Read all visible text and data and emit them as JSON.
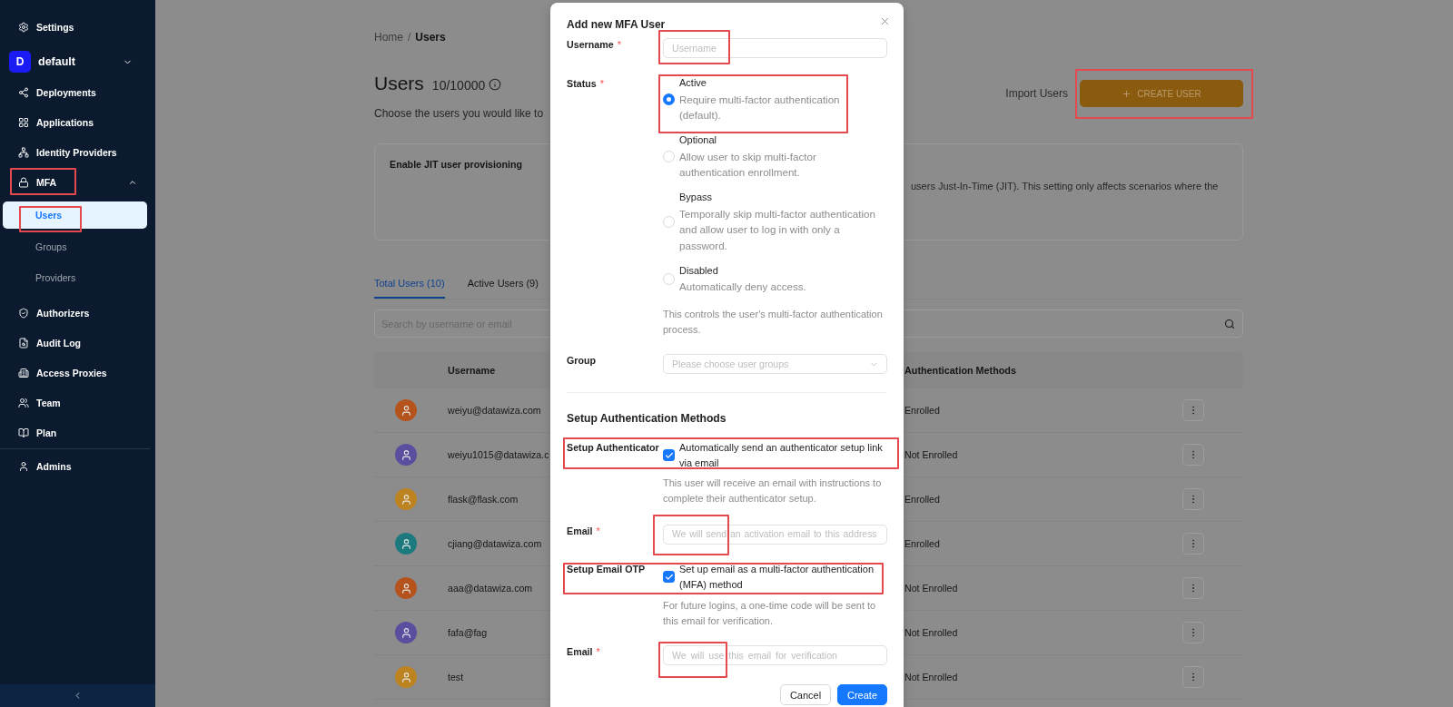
{
  "sidebar": {
    "settings": {
      "label": "Settings"
    },
    "workspace": {
      "initial": "D",
      "name": "default",
      "expanded": false
    },
    "items": [
      {
        "label": "Deployments",
        "selected": false,
        "highlighted": false
      },
      {
        "label": "Applications",
        "selected": false,
        "highlighted": false
      },
      {
        "label": "Identity Providers",
        "selected": false,
        "highlighted": false
      },
      {
        "label": "MFA",
        "selected": false,
        "highlighted": true,
        "expanded": true,
        "children": [
          {
            "label": "Users",
            "selected": true,
            "highlighted": true
          },
          {
            "label": "Groups",
            "selected": false,
            "highlighted": false
          },
          {
            "label": "Providers",
            "selected": false,
            "highlighted": false
          }
        ]
      },
      {
        "label": "Authorizers",
        "selected": false,
        "highlighted": false
      },
      {
        "label": "Audit Log",
        "selected": false,
        "highlighted": false
      },
      {
        "label": "Access Proxies",
        "selected": false,
        "highlighted": false
      },
      {
        "label": "Team",
        "selected": false,
        "highlighted": false
      },
      {
        "label": "Plan",
        "selected": false,
        "highlighted": false
      }
    ],
    "footer_items": [
      {
        "label": "Admins",
        "selected": false,
        "highlighted": false
      }
    ]
  },
  "breadcrumb": {
    "items": [
      {
        "label": "Home"
      },
      {
        "label": "Users"
      }
    ],
    "separator": "/"
  },
  "header": {
    "title": "Users",
    "count": "10/10000",
    "description": "Choose the users you would like to",
    "import_label": "Import Users",
    "create_button": {
      "label": "CREATE USER",
      "highlighted": true
    }
  },
  "jit_card": {
    "title": "Enable JIT user provisioning",
    "description": "users Just-In-Time (JIT). This setting only affects scenarios where the"
  },
  "tabs": [
    {
      "label": "Total Users (10)",
      "selected": true
    },
    {
      "label": "Active Users (9)",
      "selected": false
    }
  ],
  "search": {
    "placeholder": "Search by username or email"
  },
  "table": {
    "columns": [
      {
        "label": "Username"
      },
      {
        "label": "Authentication Methods"
      }
    ],
    "rows": [
      {
        "username": "weiyu@datawiza.com",
        "color": "#b4531c",
        "auth_methods": "Enrolled"
      },
      {
        "username": "weiyu1015@datawiza.c",
        "color": "#5a4e9e",
        "auth_methods": "Not Enrolled"
      },
      {
        "username": "flask@flask.com",
        "color": "#bd8320",
        "auth_methods": "Enrolled"
      },
      {
        "username": "cjiang@datawiza.com",
        "color": "#1c7a7e",
        "auth_methods": "Enrolled"
      },
      {
        "username": "aaa@datawiza.com",
        "color": "#b4531c",
        "auth_methods": "Not Enrolled"
      },
      {
        "username": "fafa@fag",
        "color": "#5a4e9e",
        "auth_methods": "Not Enrolled"
      },
      {
        "username": "test",
        "color": "#bd8320",
        "auth_methods": "Not Enrolled"
      }
    ]
  },
  "modal": {
    "title": "Add new MFA User",
    "username": {
      "label": "Username",
      "required_mark": "*",
      "placeholder": "Username",
      "highlighted": true
    },
    "status": {
      "label": "Status",
      "required_mark": "*",
      "options": [
        {
          "label": "Active",
          "description": "Require multi-factor authentication (default).",
          "selected": true,
          "highlighted": true
        },
        {
          "label": "Optional",
          "description": "Allow user to skip multi-factor authentication enrollment.",
          "selected": false,
          "highlighted": false
        },
        {
          "label": "Bypass",
          "description": "Temporally skip multi-factor authentication and allow user to log in with only a password.",
          "selected": false,
          "highlighted": false
        },
        {
          "label": "Disabled",
          "description": "Automatically deny access.",
          "selected": false,
          "highlighted": false
        }
      ],
      "help": "This controls the user's multi-factor authentication process."
    },
    "group": {
      "label": "Group",
      "placeholder": "Please choose user groups"
    },
    "methods_title": "Setup Authentication Methods",
    "methods": [
      {
        "label": "Setup Authenticator",
        "option": "Automatically send an authenticator setup link via email",
        "checked": true,
        "highlighted": true,
        "help": "This user will receive an email with instructions to complete their authenticator setup.",
        "email": {
          "label": "Email",
          "required_mark": "*",
          "placeholder": "We will send an activation email to this address",
          "highlighted": true
        }
      },
      {
        "label": "Setup Email OTP",
        "option": "Set up email as a multi-factor authentication (MFA) method",
        "checked": true,
        "highlighted": true,
        "help": "For future logins, a one-time code will be sent to this email for verification.",
        "email": {
          "label": "Email",
          "required_mark": "*",
          "placeholder": "We will use this email for verification",
          "highlighted": true
        }
      }
    ],
    "buttons": [
      {
        "label": "Cancel",
        "kind": "default"
      },
      {
        "label": "Create",
        "kind": "primary"
      }
    ]
  }
}
